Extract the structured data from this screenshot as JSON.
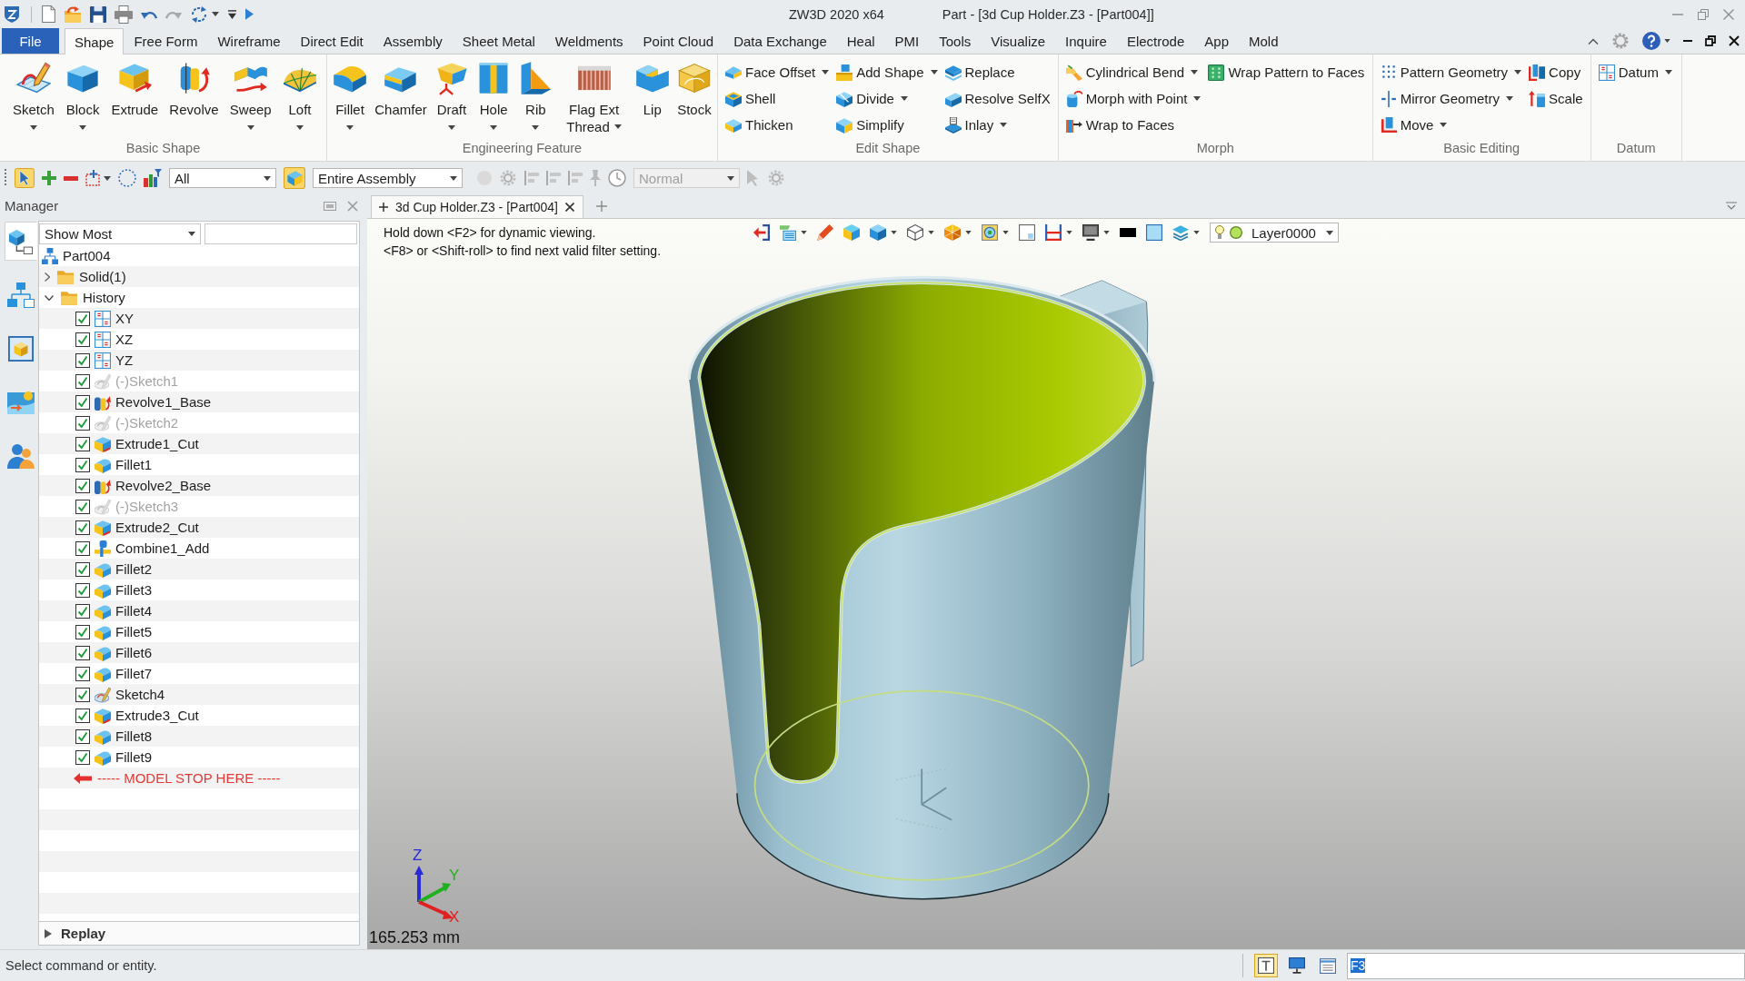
{
  "title_bar": {
    "app": "ZW3D 2020 x64",
    "document": "Part - [3d Cup Holder.Z3 - [Part004]]"
  },
  "menu_tabs": [
    {
      "label": "File",
      "kind": "file",
      "selected": false
    },
    {
      "label": "Shape",
      "kind": "tab",
      "selected": true
    },
    {
      "label": "Free Form",
      "kind": "tab",
      "selected": false
    },
    {
      "label": "Wireframe",
      "kind": "tab",
      "selected": false
    },
    {
      "label": "Direct Edit",
      "kind": "tab",
      "selected": false
    },
    {
      "label": "Assembly",
      "kind": "tab",
      "selected": false
    },
    {
      "label": "Sheet Metal",
      "kind": "tab",
      "selected": false
    },
    {
      "label": "Weldments",
      "kind": "tab",
      "selected": false
    },
    {
      "label": "Point Cloud",
      "kind": "tab",
      "selected": false
    },
    {
      "label": "Data Exchange",
      "kind": "tab",
      "selected": false
    },
    {
      "label": "Heal",
      "kind": "tab",
      "selected": false
    },
    {
      "label": "PMI",
      "kind": "tab",
      "selected": false
    },
    {
      "label": "Tools",
      "kind": "tab",
      "selected": false
    },
    {
      "label": "Visualize",
      "kind": "tab",
      "selected": false
    },
    {
      "label": "Inquire",
      "kind": "tab",
      "selected": false
    },
    {
      "label": "Electrode",
      "kind": "tab",
      "selected": false
    },
    {
      "label": "App",
      "kind": "tab",
      "selected": false
    },
    {
      "label": "Mold",
      "kind": "tab",
      "selected": false
    }
  ],
  "ribbon": {
    "groups": [
      {
        "title": "Basic Shape",
        "kind": "large",
        "buttons": [
          {
            "label": "Sketch",
            "dropdown": true
          },
          {
            "label": "Block",
            "dropdown": true
          },
          {
            "label": "Extrude",
            "dropdown": false
          },
          {
            "label": "Revolve",
            "dropdown": false
          },
          {
            "label": "Sweep",
            "dropdown": true
          },
          {
            "label": "Loft",
            "dropdown": true
          }
        ]
      },
      {
        "title": "Engineering Feature",
        "kind": "large",
        "buttons": [
          {
            "label": "Fillet",
            "dropdown": true
          },
          {
            "label": "Chamfer",
            "dropdown": false
          },
          {
            "label": "Draft",
            "dropdown": true
          },
          {
            "label": "Hole",
            "dropdown": true
          },
          {
            "label": "Rib",
            "dropdown": true
          },
          {
            "label": "Flag Ext Thread",
            "dropdown": true
          },
          {
            "label": "Lip",
            "dropdown": false
          },
          {
            "label": "Stock",
            "dropdown": false
          }
        ]
      },
      {
        "title": "Edit Shape",
        "kind": "small",
        "columns": [
          [
            {
              "label": "Face Offset",
              "dropdown": true
            },
            {
              "label": "Shell",
              "dropdown": false
            },
            {
              "label": "Thicken",
              "dropdown": false
            }
          ],
          [
            {
              "label": "Add Shape",
              "dropdown": true
            },
            {
              "label": "Divide",
              "dropdown": true
            },
            {
              "label": "Simplify",
              "dropdown": false
            }
          ],
          [
            {
              "label": "Replace",
              "dropdown": false
            },
            {
              "label": "Resolve SelfX",
              "dropdown": false
            },
            {
              "label": "Inlay",
              "dropdown": true
            }
          ]
        ]
      },
      {
        "title": "Morph",
        "kind": "small",
        "columns": [
          [
            {
              "label": "Cylindrical Bend",
              "dropdown": true
            },
            {
              "label": "Morph with Point",
              "dropdown": true
            },
            {
              "label": "Wrap to Faces",
              "dropdown": false
            }
          ],
          [
            {
              "label": "Wrap Pattern to Faces",
              "dropdown": false
            }
          ]
        ]
      },
      {
        "title": "Basic Editing",
        "kind": "small",
        "columns": [
          [
            {
              "label": "Pattern Geometry",
              "dropdown": true
            },
            {
              "label": "Mirror Geometry",
              "dropdown": true
            },
            {
              "label": "Move",
              "dropdown": true
            }
          ],
          [
            {
              "label": "Copy",
              "dropdown": false
            },
            {
              "label": "Scale",
              "dropdown": false
            }
          ]
        ]
      },
      {
        "title": "Datum",
        "kind": "small",
        "columns": [
          [
            {
              "label": "Datum",
              "dropdown": true
            }
          ]
        ]
      }
    ]
  },
  "toolbar": {
    "filter": {
      "value": "All"
    },
    "scope": {
      "value": "Entire Assembly"
    },
    "display_mode": {
      "value": "Normal",
      "disabled": true
    }
  },
  "manager": {
    "title": "Manager",
    "side_tabs": [
      {
        "selected": true
      },
      {
        "selected": false
      },
      {
        "selected": false
      },
      {
        "selected": false
      },
      {
        "selected": false
      }
    ],
    "filter": {
      "value": "Show Most"
    },
    "tree": [
      {
        "label": "Part004",
        "kind": "part",
        "children": [
          {
            "label": "Solid(1)",
            "kind": "folder",
            "expanded": false
          },
          {
            "label": "History",
            "kind": "folder",
            "expanded": true,
            "children": [
              {
                "label": "XY",
                "kind": "datum",
                "checked": true,
                "dimmed": false
              },
              {
                "label": "XZ",
                "kind": "datum",
                "checked": true,
                "dimmed": false
              },
              {
                "label": "YZ",
                "kind": "datum",
                "checked": true,
                "dimmed": false
              },
              {
                "label": "(-)Sketch1",
                "kind": "sketch",
                "checked": true,
                "dimmed": true
              },
              {
                "label": "Revolve1_Base",
                "kind": "revolve",
                "checked": true,
                "dimmed": false
              },
              {
                "label": "(-)Sketch2",
                "kind": "sketch",
                "checked": true,
                "dimmed": true
              },
              {
                "label": "Extrude1_Cut",
                "kind": "extrude",
                "checked": true,
                "dimmed": false
              },
              {
                "label": "Fillet1",
                "kind": "fillet",
                "checked": true,
                "dimmed": false
              },
              {
                "label": "Revolve2_Base",
                "kind": "revolve",
                "checked": true,
                "dimmed": false
              },
              {
                "label": "(-)Sketch3",
                "kind": "sketch",
                "checked": true,
                "dimmed": true
              },
              {
                "label": "Extrude2_Cut",
                "kind": "extrude",
                "checked": true,
                "dimmed": false
              },
              {
                "label": "Combine1_Add",
                "kind": "combine",
                "checked": true,
                "dimmed": false
              },
              {
                "label": "Fillet2",
                "kind": "fillet",
                "checked": true,
                "dimmed": false
              },
              {
                "label": "Fillet3",
                "kind": "fillet",
                "checked": true,
                "dimmed": false
              },
              {
                "label": "Fillet4",
                "kind": "fillet",
                "checked": true,
                "dimmed": false
              },
              {
                "label": "Fillet5",
                "kind": "fillet",
                "checked": true,
                "dimmed": false
              },
              {
                "label": "Fillet6",
                "kind": "fillet",
                "checked": true,
                "dimmed": false
              },
              {
                "label": "Fillet7",
                "kind": "fillet",
                "checked": true,
                "dimmed": false
              },
              {
                "label": "Sketch4",
                "kind": "sketch",
                "checked": true,
                "dimmed": false
              },
              {
                "label": "Extrude3_Cut",
                "kind": "extrude",
                "checked": true,
                "dimmed": false
              },
              {
                "label": "Fillet8",
                "kind": "fillet",
                "checked": true,
                "dimmed": false
              },
              {
                "label": "Fillet9",
                "kind": "fillet",
                "checked": true,
                "dimmed": false
              }
            ]
          }
        ]
      }
    ],
    "stop_marker": "----- MODEL STOP HERE -----",
    "replay": {
      "label": "Replay",
      "expanded": false
    }
  },
  "viewport": {
    "tab": {
      "label": "3d Cup Holder.Z3 - [Part004]",
      "selected": true
    },
    "hints": [
      "Hold down <F2> for dynamic viewing.",
      "<F8> or <Shift-roll> to find next valid filter setting."
    ],
    "layer": {
      "value": "Layer0000"
    },
    "triad": {
      "z": "Z",
      "y": "Y",
      "x": "X"
    },
    "scale": "165.253 mm"
  },
  "status_bar": {
    "prompt": "Select command or entity.",
    "tools": [
      {
        "selected": true
      },
      {
        "selected": false
      },
      {
        "selected": false
      }
    ],
    "command_field": {
      "value": "F3"
    }
  }
}
